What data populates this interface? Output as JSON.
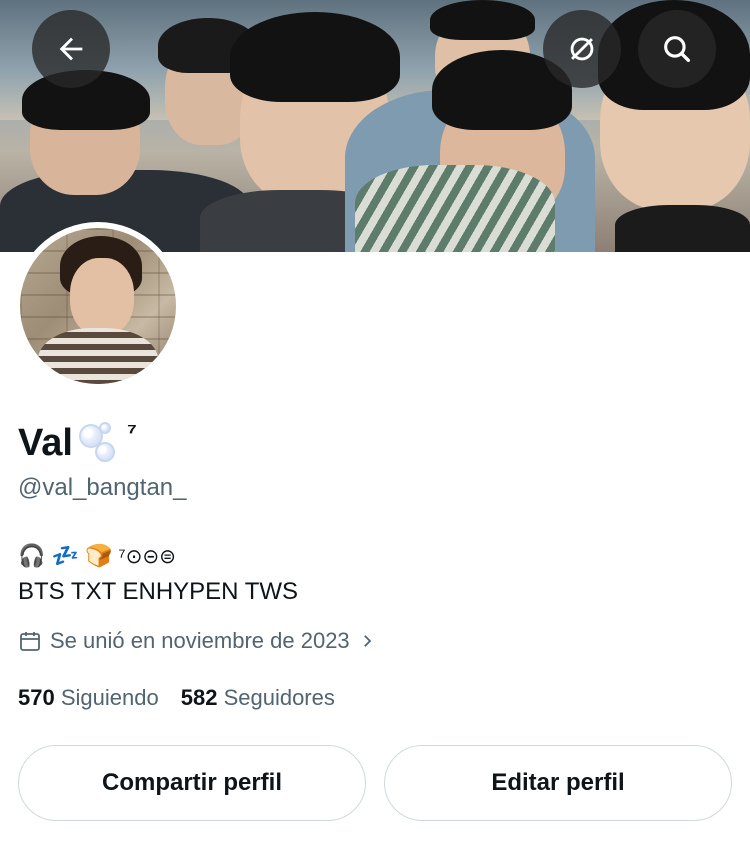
{
  "header": {
    "back_icon": "arrow-left-icon",
    "translate_icon": "no-translation-icon",
    "search_icon": "search-icon"
  },
  "profile": {
    "name": "Val",
    "name_suffix": "⁷",
    "handle": "@val_bangtan_",
    "bio_emoji_line": "🎧 💤 🍞",
    "bio_symbols": "⁷⊙⊝⊜",
    "bio_text": "BTS TXT ENHYPEN TWS",
    "joined": "Se unió en noviembre de 2023",
    "following_count": "570",
    "following_label": "Siguiendo",
    "followers_count": "582",
    "followers_label": "Seguidores"
  },
  "actions": {
    "share_label": "Compartir perfil",
    "edit_label": "Editar perfil"
  },
  "colors": {
    "text_primary": "#0f1419",
    "text_secondary": "#536471",
    "border": "#cfd9de"
  }
}
